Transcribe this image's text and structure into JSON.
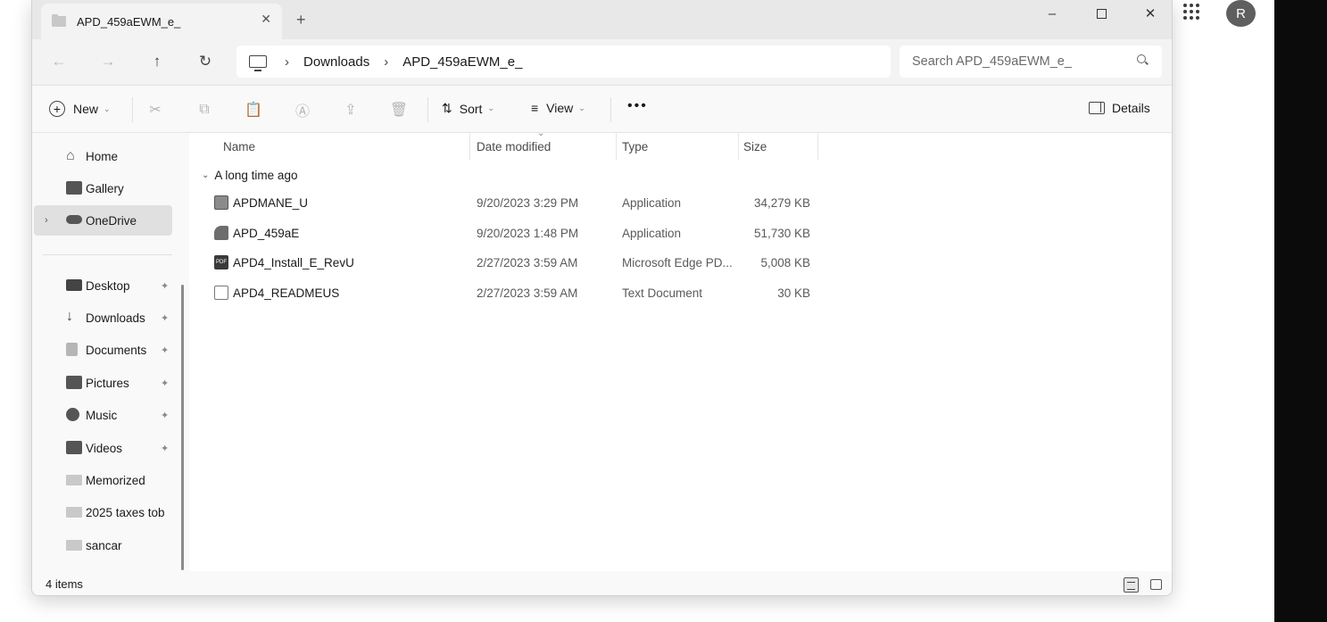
{
  "window": {
    "tab_title": "APD_459aEWM_e_",
    "tab_close": "✕",
    "tab_new": "+",
    "minimize": "–",
    "close": "✕"
  },
  "nav": {
    "back": "←",
    "forward": "→",
    "up": "↑",
    "refresh": "↻",
    "breadcrumb": [
      "Downloads",
      "APD_459aEWM_e_"
    ],
    "breadcrumb_sep": "›",
    "search_placeholder": "Search APD_459aEWM_e_"
  },
  "toolbar": {
    "new_label": "New",
    "cut": "✂",
    "copy": "⧉",
    "paste": "📋",
    "rename": "Ⓐ",
    "share": "⇪",
    "delete": "🗑",
    "sort_label": "Sort",
    "view_label": "View",
    "more_label": "•••",
    "details_label": "Details",
    "chevron": "⌄"
  },
  "sidebar": {
    "items": [
      {
        "label": "Home",
        "icon": "home-icon"
      },
      {
        "label": "Gallery",
        "icon": "gallery-icon"
      },
      {
        "label": "OneDrive",
        "icon": "cloud-icon",
        "active": true
      },
      {
        "label": "Desktop",
        "icon": "desktop-icon",
        "pinned": true
      },
      {
        "label": "Downloads",
        "icon": "download-icon",
        "pinned": true
      },
      {
        "label": "Documents",
        "icon": "document-icon",
        "pinned": true
      },
      {
        "label": "Pictures",
        "icon": "picture-icon",
        "pinned": true
      },
      {
        "label": "Music",
        "icon": "music-icon",
        "pinned": true
      },
      {
        "label": "Videos",
        "icon": "video-icon",
        "pinned": true
      },
      {
        "label": "Memorized",
        "icon": "folder-icon"
      },
      {
        "label": "2025 taxes tob",
        "icon": "folder-icon"
      },
      {
        "label": "sancar",
        "icon": "folder-icon"
      }
    ],
    "pin_glyph": "📌",
    "expand_glyph": "›"
  },
  "columns": {
    "name": "Name",
    "date": "Date modified",
    "type": "Type",
    "size": "Size"
  },
  "group": {
    "label": "A long time ago",
    "chevron": "⌄"
  },
  "files": [
    {
      "name": "APDMANE_U",
      "date": "9/20/2023 3:29 PM",
      "type": "Application",
      "size": "34,279 KB",
      "icon": "application-icon"
    },
    {
      "name": "APD_459aE",
      "date": "9/20/2023 1:48 PM",
      "type": "Application",
      "size": "51,730 KB",
      "icon": "setup-icon"
    },
    {
      "name": "APD4_Install_E_RevU",
      "date": "2/27/2023 3:59 AM",
      "type": "Microsoft Edge PD...",
      "size": "5,008 KB",
      "icon": "pdf-icon"
    },
    {
      "name": "APD4_READMEUS",
      "date": "2/27/2023 3:59 AM",
      "type": "Text Document",
      "size": "30 KB",
      "icon": "text-document-icon"
    }
  ],
  "status": {
    "count": "4 items"
  },
  "account": {
    "avatar_letter": "R"
  },
  "colors": {
    "window_bg": "#f9f9f9",
    "titlebar_bg": "#e8e8e8",
    "selection": "#e0e0e0"
  }
}
